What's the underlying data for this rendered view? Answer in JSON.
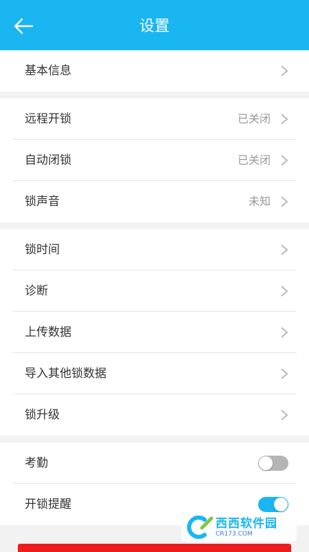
{
  "header": {
    "title": "设置",
    "back_icon": "arrow-left-icon"
  },
  "groups": [
    {
      "items": [
        {
          "label": "基本信息",
          "value": ""
        }
      ]
    },
    {
      "items": [
        {
          "label": "远程开锁",
          "value": "已关闭"
        },
        {
          "label": "自动闭锁",
          "value": "已关闭"
        },
        {
          "label": "锁声音",
          "value": "未知"
        }
      ]
    },
    {
      "items": [
        {
          "label": "锁时间",
          "value": ""
        },
        {
          "label": "诊断",
          "value": ""
        },
        {
          "label": "上传数据",
          "value": ""
        },
        {
          "label": "导入其他锁数据",
          "value": ""
        },
        {
          "label": "锁升级",
          "value": ""
        }
      ]
    },
    {
      "items": [
        {
          "label": "考勤",
          "toggle": false
        },
        {
          "label": "开锁提醒",
          "toggle": true
        }
      ]
    }
  ],
  "watermark": {
    "logo": "cr173-logo",
    "text": "西西软件园",
    "subtext": "CR173.COM"
  },
  "colors": {
    "header": "#1ab6f2",
    "toggle_on": "#1ab6f2",
    "toggle_off": "#b5b5b5",
    "bottom_button": "#ee1c1c"
  }
}
